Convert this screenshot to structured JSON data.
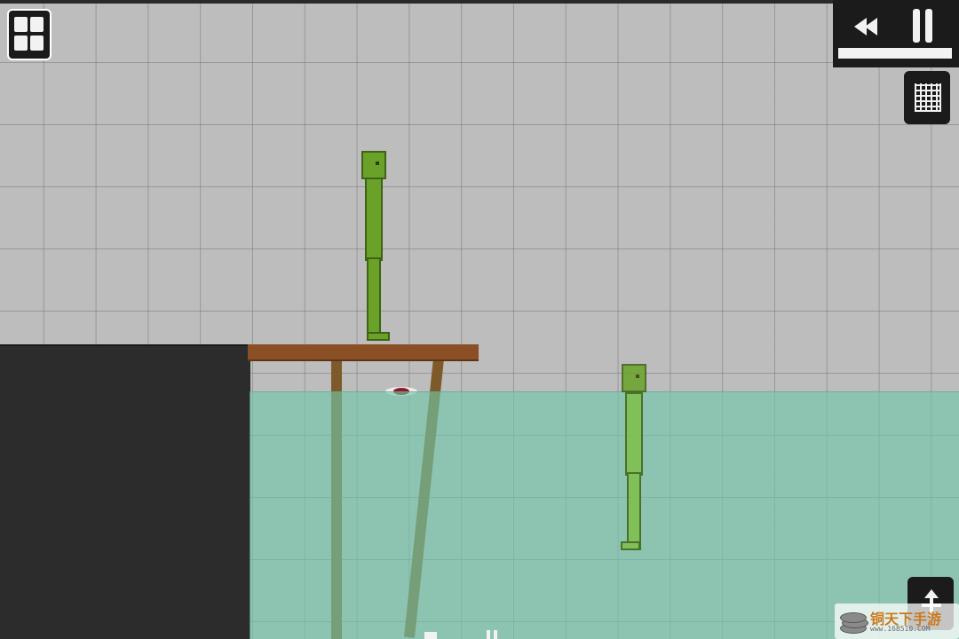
{
  "game": {
    "title": "",
    "scene": {
      "background_color": "#bdbdbd",
      "ground_color": "#2c2c2c",
      "water_color": "#70c8aa",
      "wood_color": "#8a4f25",
      "ragdoll_color": "#6aa229"
    }
  },
  "toolbar": {
    "menu_icon": "grid-2x2-icon",
    "rewind_icon": "rewind-icon",
    "pause_icon": "pause-icon",
    "time_slider_progress": 1.0,
    "grid_icon": "grid-toggle-icon",
    "move_icon": "move-arrows-icon"
  },
  "watermark": {
    "text": "铜天下手游",
    "url": "www.168510.COM"
  }
}
